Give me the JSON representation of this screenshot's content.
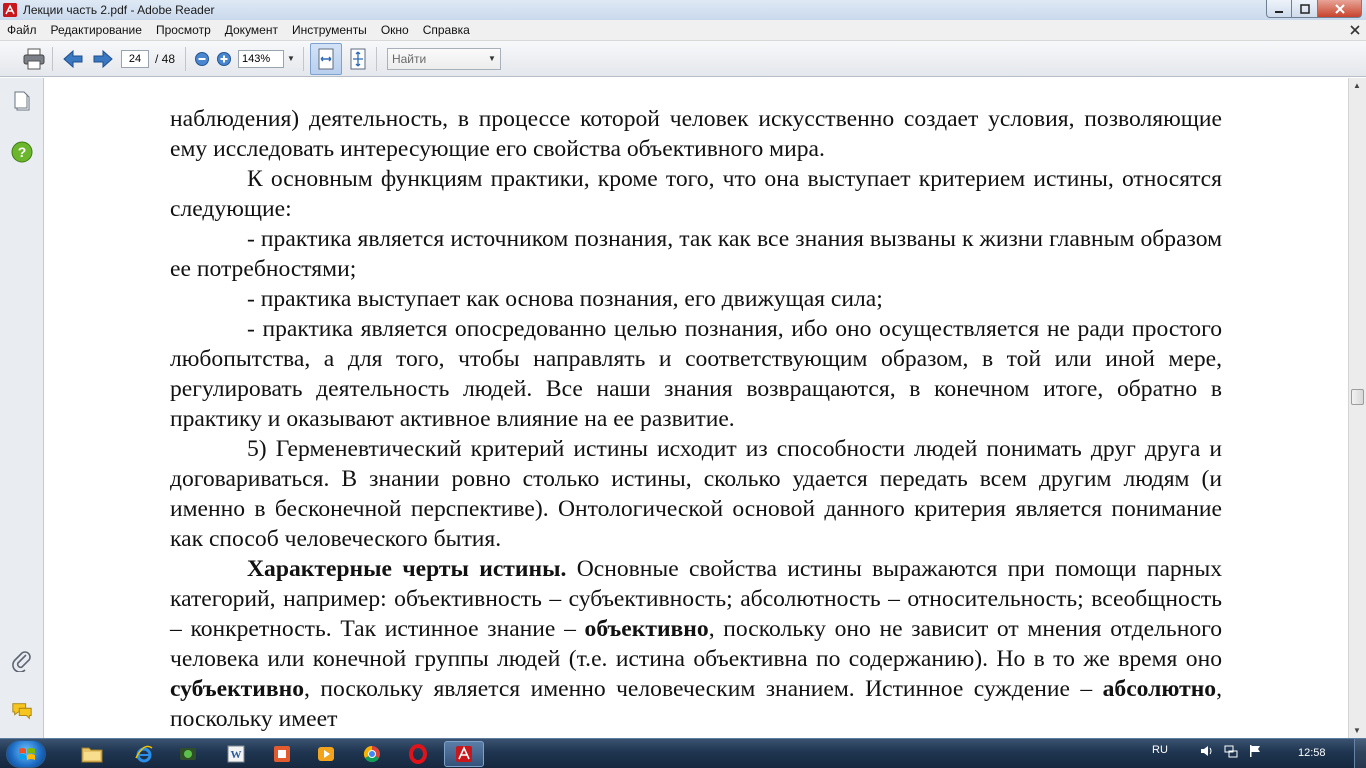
{
  "window": {
    "title": "Лекции часть 2.pdf - Adobe Reader",
    "app_icon": "adobe-reader-icon",
    "controls": [
      "minimize-icon",
      "maximize-icon",
      "close-icon"
    ]
  },
  "menubar": {
    "items": [
      "Файл",
      "Редактирование",
      "Просмотр",
      "Документ",
      "Инструменты",
      "Окно",
      "Справка"
    ]
  },
  "toolbar": {
    "current_page": "24",
    "page_total": "/ 48",
    "zoom": "143%",
    "find_placeholder": "Найти",
    "icons": [
      "print-icon",
      "previous-page-icon",
      "next-page-icon",
      "zoom-out-icon",
      "zoom-in-icon",
      "fit-width-icon",
      "fit-page-icon"
    ]
  },
  "navpane": {
    "icons": [
      "pages-icon",
      "help-icon",
      "attachments-icon",
      "comments-icon"
    ]
  },
  "document": {
    "paragraphs": [
      {
        "text": "наблюдения) деятельность, в процессе которой человек искусственно создает условия, позволяющие ему исследовать интересующие его свойства объективного мира.",
        "indent": false
      },
      {
        "text": "К основным функциям практики, кроме того, что она выступает критерием истины, относятся следующие:",
        "indent": true
      },
      {
        "text": "- практика является источником познания, так как все знания вызваны к жизни главным образом ее потребностями;",
        "indent": true
      },
      {
        "text": "- практика выступает как основа познания, его движущая сила;",
        "indent": true
      },
      {
        "text": "- практика является опосредованно целью познания, ибо оно осуществляется не ради простого любопытства, а для того, чтобы направлять и соответствующим образом, в той или иной мере, регулировать деятельность людей. Все наши знания возвращаются, в конечном итоге, обратно в практику и оказывают активное влияние на ее развитие.",
        "indent": true
      },
      {
        "text": "5) Герменевтический критерий истины исходит из способности людей понимать друг друга и договариваться. В знании ровно столько истины, сколько удается передать всем другим людям (и именно в бесконечной перспективе). Онтологической основой данного критерия является понимание как способ человеческого бытия.",
        "indent": true
      }
    ],
    "last_paragraph": {
      "s1_bold": "Характерные черты истины.",
      "s2": " Основные свойства истины выражаются при помощи парных категорий, например: объективность – субъективность; абсолютность – относительность; всеобщность – конкретность. Так истинное знание – ",
      "s3_bold": "объективно",
      "s4": ", поскольку оно не зависит от мнения отдельного человека или конечной группы людей (т.е. истина объективна по содержанию). Но в то же время оно ",
      "s5_bold": "субъективно",
      "s6": ", поскольку является именно человеческим знанием. Истинное суждение – ",
      "s7_bold": "абсолютно",
      "s8": ", поскольку имеет"
    }
  },
  "taskbar": {
    "start_icon": "windows-start-icon",
    "apps": [
      "file-explorer-icon",
      "internet-explorer-icon",
      "media-center-icon",
      "word-icon",
      "presentation-icon",
      "media-player-icon",
      "chrome-icon",
      "opera-icon",
      "adobe-reader-icon"
    ],
    "tray": {
      "language": "RU",
      "clock": "12:58",
      "icons": [
        "chevron-up-icon",
        "volume-icon",
        "network-icon",
        "flag-icon"
      ]
    }
  }
}
